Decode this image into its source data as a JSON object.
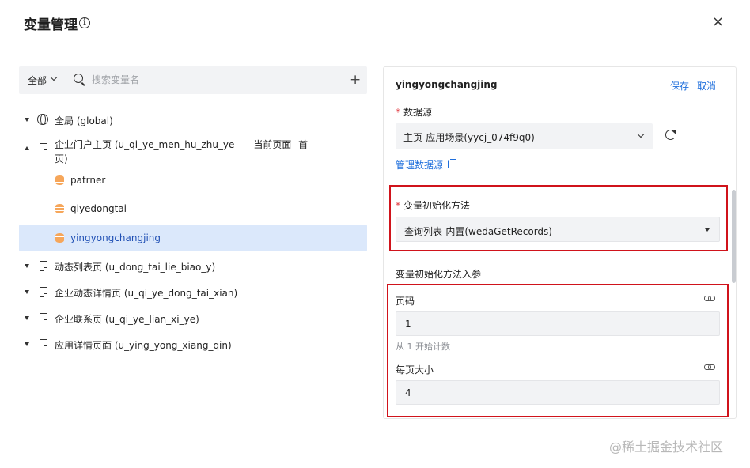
{
  "dialog": {
    "title": "变量管理",
    "info_icon": "info-circle-icon",
    "close_symbol": "×"
  },
  "search": {
    "scope_label": "全部",
    "placeholder": "搜索变量名",
    "add_symbol": "+"
  },
  "tree": {
    "global": "全局 (global)",
    "home_page_line1": "企业门户主页 (u_qi_ye_men_hu_zhu_ye——当前页面--首",
    "home_page_line2": "页)",
    "vars": [
      "patrner",
      "qiyedongtai",
      "yingyongchangjing"
    ],
    "pages": [
      "动态列表页 (u_dong_tai_lie_biao_y)",
      "企业动态详情页 (u_qi_ye_dong_tai_xian)",
      "企业联系页 (u_qi_ye_lian_xi_ye)",
      "应用详情页面 (u_ying_yong_xiang_qin)"
    ]
  },
  "editor": {
    "title": "yingyongchangjing",
    "save": "保存",
    "cancel": "取消",
    "required_mark": "*",
    "datasource_label": "数据源",
    "datasource_value": "主页-应用场景(yycj_074f9q0)",
    "manage_datasource": "管理数据源",
    "init_method_label": "变量初始化方法",
    "init_method_value": "查询列表-内置(wedaGetRecords)",
    "params_label": "变量初始化方法入参",
    "page_no_label": "页码",
    "page_no_value": "1",
    "page_no_hint": "从 1 开始计数",
    "page_size_label": "每页大小",
    "page_size_value": "4"
  },
  "colors": {
    "accent": "#1f6fdc",
    "selected_bg": "#dbe8fb",
    "highlight_box": "#d0131b",
    "db_icon": "#f6a65a"
  },
  "watermark": "@稀土掘金技术社区"
}
